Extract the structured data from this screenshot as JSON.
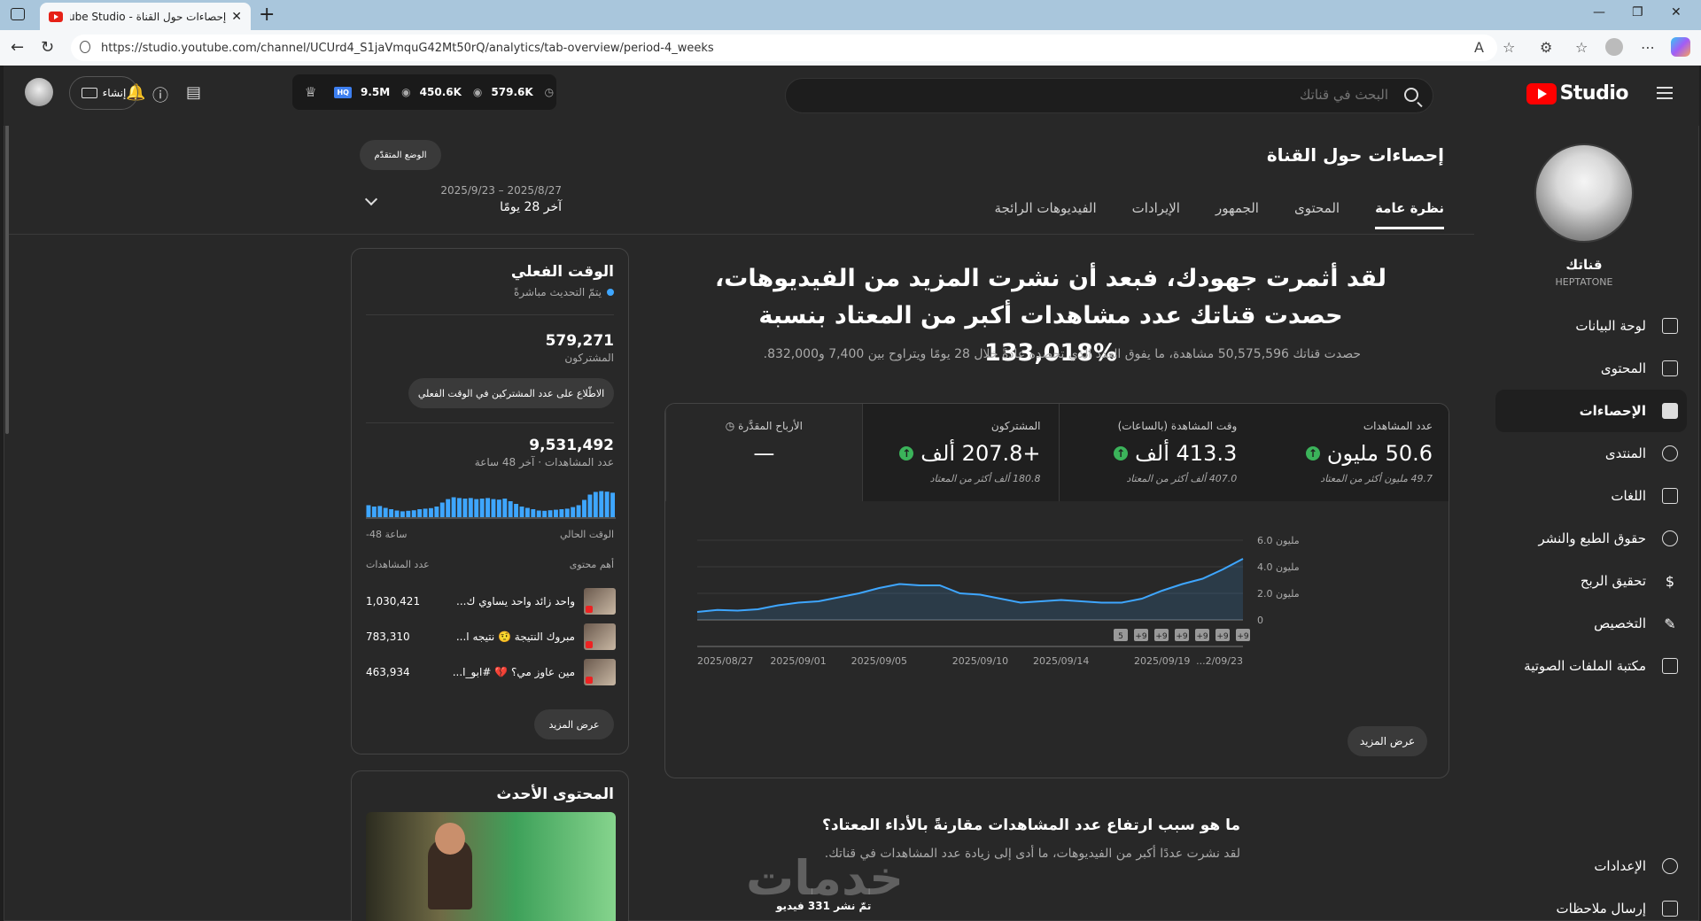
{
  "browser": {
    "tab_title": "إحصاءات حول القناة - YouTube Studio",
    "url": "https://studio.youtube.com/channel/UCUrd4_S1jaVmquG42Mt50rQ/analytics/tab-overview/period-4_weeks"
  },
  "topbar": {
    "logo_text": "Studio",
    "search_placeholder": "البحث في قناتك",
    "stat_views": "9.5M",
    "stat_watch": "450.6K",
    "stat_subs": "579.6K",
    "create_label": "إنشاء"
  },
  "sidebar": {
    "channel_label": "قناتك",
    "channel_handle": "HEPTATONE",
    "items": [
      {
        "label": "لوحة البيانات",
        "icon": "dashboard-icon"
      },
      {
        "label": "المحتوى",
        "icon": "content-icon"
      },
      {
        "label": "الإحصاءات",
        "icon": "analytics-icon"
      },
      {
        "label": "المنتدى",
        "icon": "community-icon"
      },
      {
        "label": "اللغات",
        "icon": "subtitles-icon"
      },
      {
        "label": "حقوق الطبع والنشر",
        "icon": "copyright-icon"
      },
      {
        "label": "تحقيق الربح",
        "icon": "monetization-icon"
      },
      {
        "label": "التخصيص",
        "icon": "customization-icon"
      },
      {
        "label": "مكتبة الملفات الصوتية",
        "icon": "audio-library-icon"
      }
    ],
    "settings_label": "الإعدادات",
    "feedback_label": "إرسال ملاحظات"
  },
  "main": {
    "title": "إحصاءات حول القناة",
    "advanced_mode": "الوضع المتقدّم",
    "tabs": [
      "نظرة عامة",
      "المحتوى",
      "الجمهور",
      "الإيرادات",
      "الفيديوهات الرائجة"
    ],
    "date_range": "2025/9/23 – 2025/8/27",
    "period_label": "آخر 28 يومًا",
    "headline": "لقد أثمرت جهودك، فبعد أن نشرت المزيد من الفيديوهات، حصدت قناتك عدد مشاهدات أكبر من المعتاد بنسبة %133,018",
    "subline": "حصدت قناتك 50,575,596 مشاهدة، ما يفوق العدد الذي تحصده عادةً خلال 28 يومًا ويتراوح بين 7,400 و832,000.",
    "metrics": [
      {
        "label": "عدد المشاهدات",
        "value": "50.6 مليون",
        "note": "49.7 مليون أكثر من المعتاد"
      },
      {
        "label": "وقت المشاهدة (بالساعات)",
        "value": "413.3 ألف",
        "note": "407.0 ألف أكثر من المعتاد"
      },
      {
        "label": "المشتركون",
        "value": "+207.8 ألف",
        "note": "180.8 ألف أكثر من المعتاد"
      },
      {
        "label": "الأرباح المقدَّرة",
        "value": "—",
        "note": ""
      }
    ],
    "see_more": "عرض المزيد",
    "why_title": "ما هو سبب ارتفاع عدد المشاهدات مقارنةً بالأداء المعتاد؟",
    "why_sub": "لقد نشرت عددًا أكبر من الفيديوهات، ما أدى إلى زيادة عدد المشاهدات في قناتك.",
    "published": "تمّ نشر 331 فيديو",
    "watermark": "خدمات"
  },
  "chart_data": {
    "type": "area",
    "x": [
      "2025/08/27",
      "2025/08/28",
      "2025/08/29",
      "2025/08/30",
      "2025/08/31",
      "2025/09/01",
      "2025/09/02",
      "2025/09/03",
      "2025/09/04",
      "2025/09/05",
      "2025/09/06",
      "2025/09/07",
      "2025/09/08",
      "2025/09/09",
      "2025/09/10",
      "2025/09/11",
      "2025/09/12",
      "2025/09/13",
      "2025/09/14",
      "2025/09/15",
      "2025/09/16",
      "2025/09/17",
      "2025/09/18",
      "2025/09/19",
      "2025/09/20",
      "2025/09/21",
      "2025/09/22",
      "2025/09/23"
    ],
    "values": [
      0.6,
      0.75,
      0.7,
      0.8,
      1.1,
      1.3,
      1.4,
      1.7,
      2.0,
      2.4,
      2.7,
      2.6,
      2.6,
      2.0,
      1.9,
      1.6,
      1.3,
      1.4,
      1.5,
      1.4,
      1.3,
      1.3,
      1.6,
      2.2,
      2.7,
      3.1,
      3.8,
      4.6
    ],
    "x_ticks": [
      "2025/08/27",
      "2025/09/01",
      "2025/09/05",
      "2025/09/10",
      "2025/09/14",
      "2025/09/19",
      "...2/09/23"
    ],
    "y_ticks": [
      "6.0 مليون",
      "4.0 مليون",
      "2.0 مليون",
      "0"
    ],
    "ylim": [
      0,
      6
    ],
    "markers": [
      "5",
      "+9",
      "+9",
      "+9",
      "+9",
      "+9",
      "+9"
    ],
    "color": "#3ea6ff"
  },
  "realtime": {
    "title": "الوقت الفعلي",
    "live": "يتمّ التحديث مباشرةً",
    "subs_value": "579,271",
    "subs_label": "المشتركون",
    "subs_btn": "الاطّلاع على عدد المشتركين في الوقت الفعلي",
    "views_value": "9,531,492",
    "views_label": "عدد المشاهدات · آخر 48 ساعة",
    "axis_left": "-48 ساعة",
    "axis_right": "الوقت الحالي",
    "col_content": "أهم محتوى",
    "col_views": "عدد المشاهدات",
    "bars": [
      0.45,
      0.4,
      0.42,
      0.35,
      0.3,
      0.25,
      0.22,
      0.24,
      0.26,
      0.3,
      0.32,
      0.34,
      0.4,
      0.55,
      0.68,
      0.75,
      0.72,
      0.7,
      0.72,
      0.68,
      0.7,
      0.72,
      0.68,
      0.66,
      0.7,
      0.6,
      0.5,
      0.4,
      0.35,
      0.3,
      0.25,
      0.24,
      0.26,
      0.28,
      0.3,
      0.32,
      0.38,
      0.45,
      0.65,
      0.85,
      0.95,
      0.98,
      0.96,
      0.92
    ],
    "rows": [
      {
        "title": "واحد زائد واحد يساوي ك...",
        "views": "1,030,421"
      },
      {
        "title": "مبروك النتيجة 🤨 نتيجه ا...",
        "views": "783,310"
      },
      {
        "title": "مين عاوز مي؟ 💔 #ابو_ا...",
        "views": "463,934"
      }
    ],
    "more": "عرض المزيد"
  },
  "latest": {
    "title": "المحتوى الأحدث"
  }
}
